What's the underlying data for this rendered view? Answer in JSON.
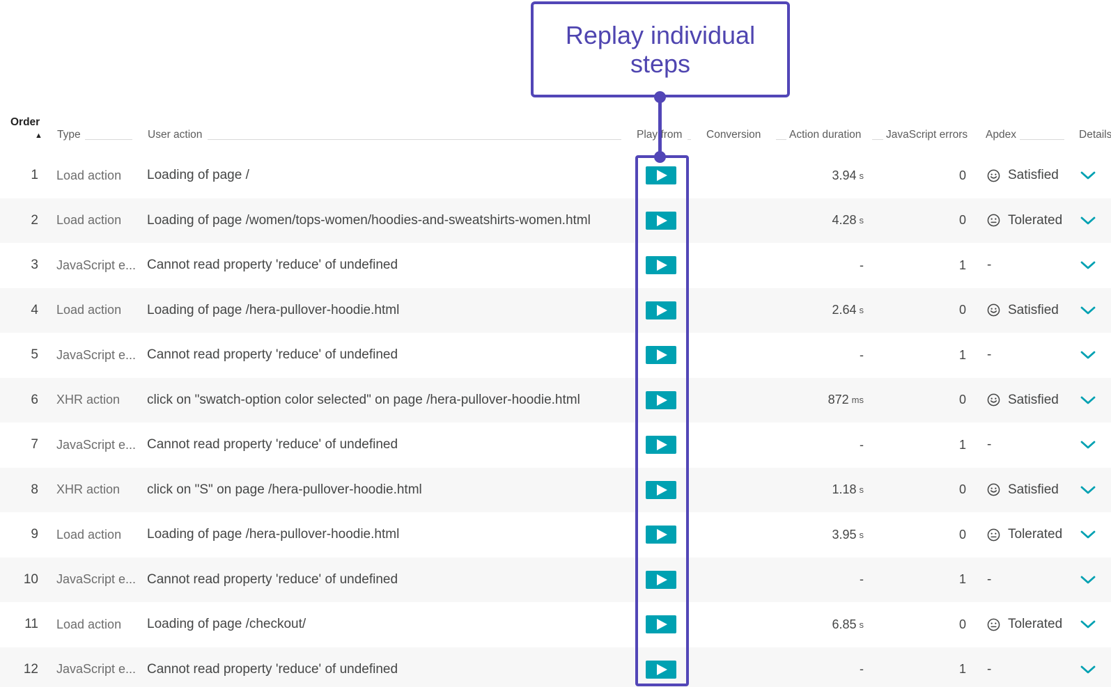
{
  "callout": {
    "text": "Replay individual steps"
  },
  "header": {
    "order": "Order",
    "sort_indicator": "▲",
    "type": "Type",
    "user_action": "User action",
    "play_from": "Play from",
    "conversion": "Conversion",
    "action_duration": "Action duration",
    "js_errors": "JavaScript errors",
    "apdex": "Apdex",
    "details": "Details"
  },
  "icons": {
    "play": "play-icon",
    "expand": "chevron-down-icon",
    "satisfied": "smile-icon",
    "tolerated": "neutral-face-icon"
  },
  "colors": {
    "play_button": "#00a1b2",
    "callout": "#5246b7",
    "chevron": "#00a1b2"
  },
  "rows": [
    {
      "order": "1",
      "type": "Load action",
      "action": "Loading of page /",
      "duration": "3.94",
      "unit": "s",
      "errors": "0",
      "apdex": "Satisfied"
    },
    {
      "order": "2",
      "type": "Load action",
      "action": "Loading of page /women/tops-women/hoodies-and-sweatshirts-women.html",
      "duration": "4.28",
      "unit": "s",
      "errors": "0",
      "apdex": "Tolerated"
    },
    {
      "order": "3",
      "type": "JavaScript e...",
      "action": "Cannot read property 'reduce' of undefined",
      "duration": "-",
      "unit": "",
      "errors": "1",
      "apdex": "-"
    },
    {
      "order": "4",
      "type": "Load action",
      "action": "Loading of page /hera-pullover-hoodie.html",
      "duration": "2.64",
      "unit": "s",
      "errors": "0",
      "apdex": "Satisfied"
    },
    {
      "order": "5",
      "type": "JavaScript e...",
      "action": "Cannot read property 'reduce' of undefined",
      "duration": "-",
      "unit": "",
      "errors": "1",
      "apdex": "-"
    },
    {
      "order": "6",
      "type": "XHR action",
      "action": "click on \"swatch-option color selected\" on page /hera-pullover-hoodie.html",
      "duration": "872",
      "unit": "ms",
      "errors": "0",
      "apdex": "Satisfied"
    },
    {
      "order": "7",
      "type": "JavaScript e...",
      "action": "Cannot read property 'reduce' of undefined",
      "duration": "-",
      "unit": "",
      "errors": "1",
      "apdex": "-"
    },
    {
      "order": "8",
      "type": "XHR action",
      "action": "click on \"S\" on page /hera-pullover-hoodie.html",
      "duration": "1.18",
      "unit": "s",
      "errors": "0",
      "apdex": "Satisfied"
    },
    {
      "order": "9",
      "type": "Load action",
      "action": "Loading of page /hera-pullover-hoodie.html",
      "duration": "3.95",
      "unit": "s",
      "errors": "0",
      "apdex": "Tolerated"
    },
    {
      "order": "10",
      "type": "JavaScript e...",
      "action": "Cannot read property 'reduce' of undefined",
      "duration": "-",
      "unit": "",
      "errors": "1",
      "apdex": "-"
    },
    {
      "order": "11",
      "type": "Load action",
      "action": "Loading of page /checkout/",
      "duration": "6.85",
      "unit": "s",
      "errors": "0",
      "apdex": "Tolerated"
    },
    {
      "order": "12",
      "type": "JavaScript e...",
      "action": "Cannot read property 'reduce' of undefined",
      "duration": "-",
      "unit": "",
      "errors": "1",
      "apdex": "-"
    }
  ]
}
